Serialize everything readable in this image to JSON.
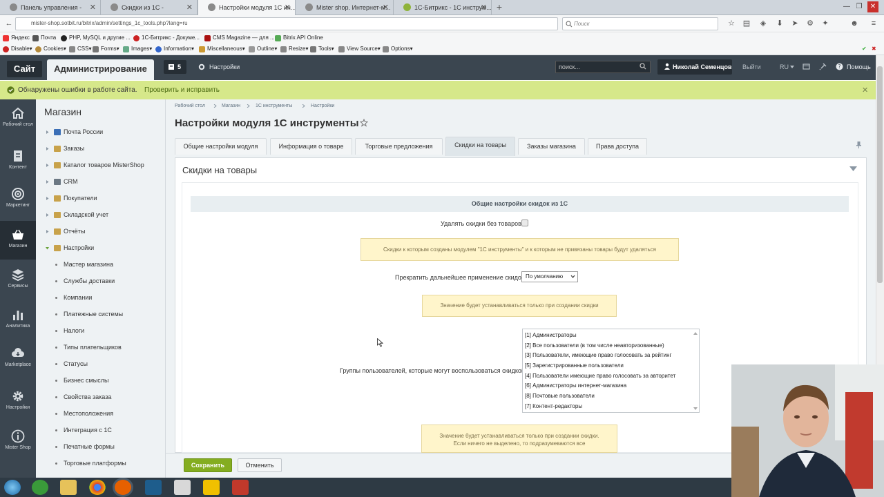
{
  "browser": {
    "tabs": [
      {
        "label": "Панель управления -"
      },
      {
        "label": "Скидки из 1С -"
      },
      {
        "label": "Настройки модуля 1С ин..."
      },
      {
        "label": "Mister shop. Интернет-м..."
      },
      {
        "label": "1С-Битрикс - 1С инструм..."
      }
    ],
    "new_tab": "+",
    "url": "mister-shop.sotbit.ru/bitrix/admin/settings_1c_tools.php?lang=ru",
    "search_placeholder": "Поиск",
    "bookmarks": [
      "Яндекс",
      "Почта",
      "PHP, MySQL и другие ...",
      "1С-Битрикс - Докуме...",
      "CMS Magazine — для ...",
      "Bitrix API Online"
    ],
    "dev_tools": [
      "Disable▾",
      "Cookies▾",
      "CSS▾",
      "Forms▾",
      "Images▾",
      "Information▾",
      "Miscellaneous▾",
      "Outline▾",
      "Resize▾",
      "Tools▾",
      "View Source▾",
      "Options▾"
    ]
  },
  "admin": {
    "site_btn": "Сайт",
    "admin_btn": "Администрирование",
    "notif_count": "5",
    "settings": "Настройки",
    "search_placeholder": "поиск...",
    "user": "Николай Семенцов",
    "logout": "Выйти",
    "lang": "RU",
    "help": "Помощь"
  },
  "alert": {
    "text": "Обнаружены ошибки в работе сайта.",
    "link": "Проверить и исправить"
  },
  "rail": [
    {
      "label": "Рабочий стол",
      "icon": "home-icon"
    },
    {
      "label": "Контент",
      "icon": "document-icon"
    },
    {
      "label": "Маркетинг",
      "icon": "target-icon"
    },
    {
      "label": "Магазин",
      "icon": "basket-icon",
      "active": true
    },
    {
      "label": "Сервисы",
      "icon": "layers-icon"
    },
    {
      "label": "Аналитика",
      "icon": "chart-icon"
    },
    {
      "label": "Marketplace",
      "icon": "cloud-download-icon"
    },
    {
      "label": "Настройки",
      "icon": "gear-icon"
    },
    {
      "label": "Mister Shop",
      "icon": "info-icon"
    }
  ],
  "menu": {
    "title": "Магазин",
    "items": [
      "Почта России",
      "Заказы",
      "Каталог товаров MisterShop",
      "CRM",
      "Покупатели",
      "Складской учет",
      "Отчёты",
      "Настройки"
    ],
    "sub_items": [
      "Мастер магазина",
      "Службы доставки",
      "Компании",
      "Платежные системы",
      "Налоги",
      "Типы плательщиков",
      "Статусы",
      "Бизнес смыслы",
      "Свойства заказа",
      "Местоположения",
      "Интеграция с 1С",
      "Печатные формы",
      "Торговые платформы"
    ]
  },
  "breadcrumb": [
    "Рабочий стол",
    "Магазин",
    "1С инструменты",
    "Настройки"
  ],
  "page_title": "Настройки модуля 1С инструменты",
  "tabs": [
    "Общие настройки модуля",
    "Информация о товаре",
    "Торговые предложения",
    "Скидки на товары",
    "Заказы магазина",
    "Права доступа"
  ],
  "panel": {
    "title": "Скидки на товары",
    "section": "Общие настройки скидок из 1С",
    "delete_label": "Удалять скидки без товаров",
    "note1": "Скидки к которым созданы модулем \"1С инструменты\" и к которым не привязаны товары будут удаляться",
    "stop_label": "Прекратить дальнейшее применение скидок",
    "stop_value": "По умолчанию",
    "note2": "Значение будет устанавливаться только при создании скидки",
    "groups_label": "Группы пользователей, которые могут воспользоваться скидкой",
    "groups": [
      "[1] Администраторы",
      "[2] Все пользователи (в том числе неавторизованные)",
      "[3] Пользователи, имеющие право голосовать за рейтинг",
      "[5] Зарегистрированные пользователи",
      "[4] Пользователи имеющие право голосовать за авторитет",
      "[6] Администраторы интернет-магазина",
      "[8] Почтовые пользователи",
      "[7] Контент-редакторы"
    ],
    "note3_line1": "Значение будет устанавливаться только при создании скидки.",
    "note3_line2": "Если ничего не выделено, то подразумеваются все"
  },
  "footer": {
    "save": "Сохранить",
    "cancel": "Отменить"
  },
  "colors": {
    "bx_dark": "#3b4650",
    "alert": "#d6e88a",
    "save": "#84ad20",
    "note": "#fff5cb"
  }
}
